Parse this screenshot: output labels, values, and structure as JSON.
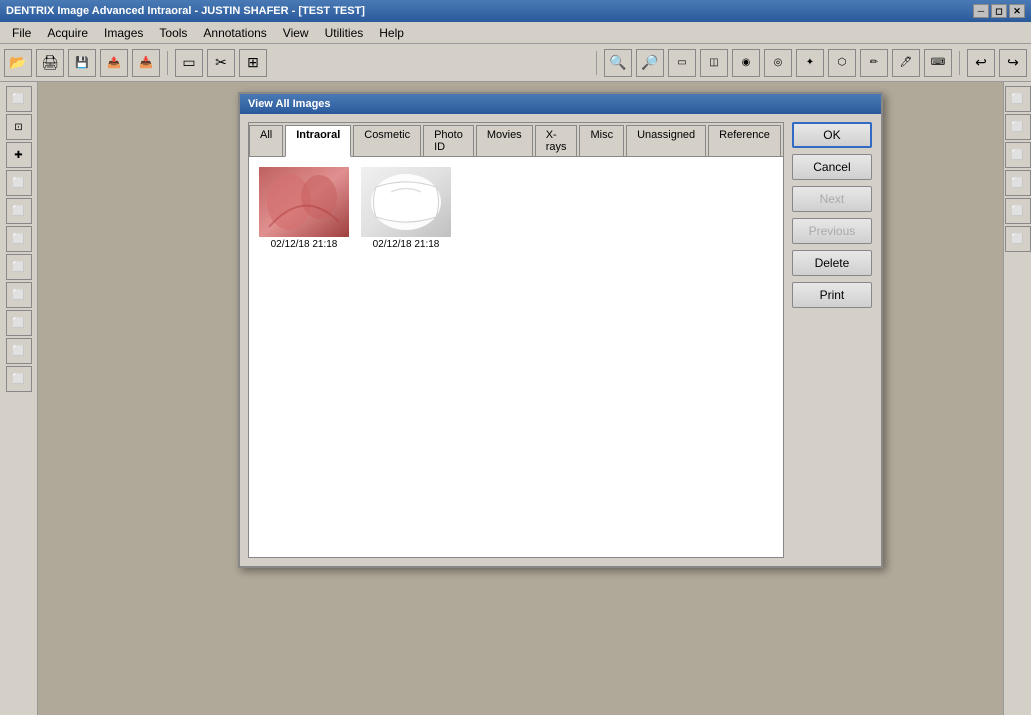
{
  "titleBar": {
    "title": "DENTRIX Image Advanced Intraoral - JUSTIN SHAFER - [TEST TEST]",
    "buttons": [
      "minimize",
      "restore",
      "close"
    ]
  },
  "menuBar": {
    "items": [
      "File",
      "Acquire",
      "Images",
      "Tools",
      "Annotations",
      "View",
      "Utilities",
      "Help"
    ]
  },
  "toolbar": {
    "groups": [
      [
        "📁",
        "🖨",
        "💾",
        "📤",
        "📥"
      ],
      [
        "◻",
        "✂",
        "⊞"
      ],
      [],
      [
        "🔍",
        "🔎",
        "⬜",
        "⬜",
        "⬜",
        "⬜",
        "⬜",
        "⬜",
        "⬜",
        "⬜",
        "⬜",
        "↩",
        "↪"
      ]
    ]
  },
  "leftSidebar": {
    "buttons": [
      "⬜",
      "⬜",
      "✚",
      "⬜",
      "⬜",
      "⬜",
      "⬜",
      "⬜",
      "⬜",
      "⬜",
      "⬜"
    ]
  },
  "dialog": {
    "title": "View All Images",
    "tabs": [
      {
        "label": "All",
        "active": false
      },
      {
        "label": "Intraoral",
        "active": true
      },
      {
        "label": "Cosmetic",
        "active": false
      },
      {
        "label": "Photo ID",
        "active": false
      },
      {
        "label": "Movies",
        "active": false
      },
      {
        "label": "X-rays",
        "active": false
      },
      {
        "label": "Misc",
        "active": false
      },
      {
        "label": "Unassigned",
        "active": false
      },
      {
        "label": "Reference",
        "active": false
      }
    ],
    "images": [
      {
        "timestamp": "02/12/18 21:18",
        "type": "tooth1"
      },
      {
        "timestamp": "02/12/18 21:18",
        "type": "tooth2"
      }
    ],
    "buttons": [
      {
        "label": "OK",
        "default": true,
        "disabled": false,
        "name": "ok-button"
      },
      {
        "label": "Cancel",
        "default": false,
        "disabled": false,
        "name": "cancel-button"
      },
      {
        "label": "Next",
        "default": false,
        "disabled": true,
        "name": "next-button"
      },
      {
        "label": "Previous",
        "default": false,
        "disabled": true,
        "name": "previous-button"
      },
      {
        "label": "Delete",
        "default": false,
        "disabled": false,
        "name": "delete-button"
      },
      {
        "label": "Print",
        "default": false,
        "disabled": false,
        "name": "print-button"
      }
    ]
  }
}
